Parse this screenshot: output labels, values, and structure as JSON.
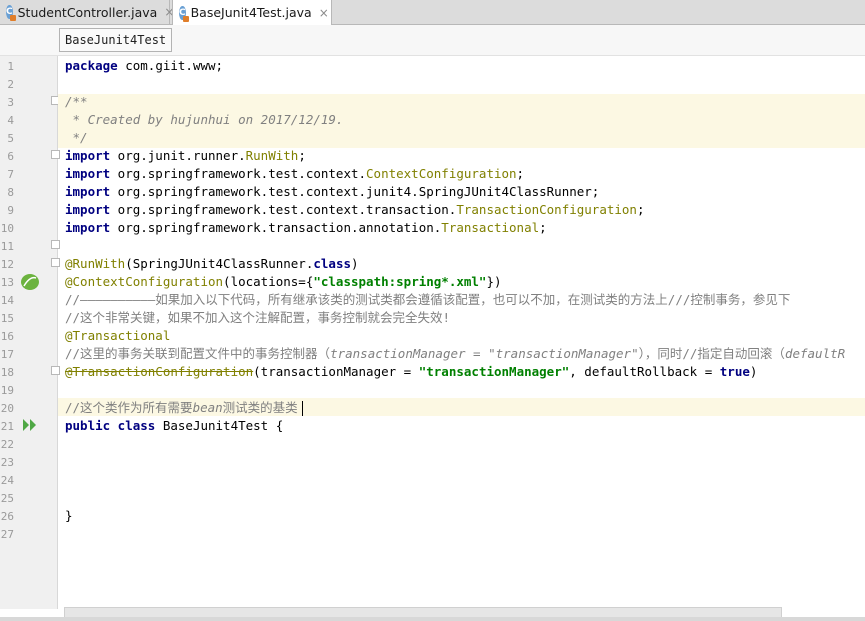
{
  "tabs": [
    {
      "label": "StudentController.java",
      "close": "×",
      "icon": "class-icon"
    },
    {
      "label": "BaseJunit4Test.java",
      "close": "×",
      "icon": "class-icon"
    }
  ],
  "breadcrumb": "BaseJunit4Test",
  "line_numbers": [
    "1",
    "2",
    "3",
    "4",
    "5",
    "6",
    "7",
    "8",
    "9",
    "10",
    "11",
    "12",
    "13",
    "14",
    "15",
    "16",
    "17",
    "18",
    "19",
    "20",
    "21",
    "22",
    "23",
    "24",
    "25",
    "26",
    "27"
  ],
  "code": {
    "l1": {
      "kw": "package",
      "rest": " com.giit.www;"
    },
    "l3": "/**",
    "l4": " * Created by hujunhui on 2017/12/19.",
    "l5": " */",
    "l6": {
      "kw": "import",
      "pkg": " org.junit.runner.",
      "cls": "RunWith",
      "end": ";"
    },
    "l7": {
      "kw": "import",
      "pkg": " org.springframework.test.context.",
      "cls": "ContextConfiguration",
      "end": ";"
    },
    "l8": {
      "kw": "import",
      "pkg": " org.springframework.test.context.junit4.SpringJUnit4ClassRunner;"
    },
    "l9": {
      "kw": "import",
      "pkg": " org.springframework.test.context.transaction.",
      "cls": "TransactionConfiguration",
      "end": ";"
    },
    "l10": {
      "kw": "import",
      "pkg": " org.springframework.transaction.annotation.",
      "cls": "Transactional",
      "end": ";"
    },
    "l12": {
      "ann": "@RunWith",
      "open": "(SpringJUnit4ClassRunner.",
      "kw": "class",
      "close": ")"
    },
    "l13": {
      "ann": "@ContextConfiguration",
      "open": "(locations={",
      "str": "\"classpath:spring*.xml\"",
      "close": "})"
    },
    "l14": "//——————————如果加入以下代码，所有继承该类的测试类都会遵循该配置，也可以不加，在测试类的方法上///控制事务，参见下",
    "l15": "//这个非常关键，如果不加入这个注解配置，事务控制就会完全失效!",
    "l16": "@Transactional",
    "l17a": "//这里的事务关联到配置文件中的事务控制器（",
    "l17b": "transactionManager = \"transactionManager\"",
    "l17c": "），同时//指定自动回滚（",
    "l17d": "defaultR",
    "l18": {
      "ann": "@TransactionConfiguration",
      "open": "(transactionManager = ",
      "str": "\"transactionManager\"",
      "mid": ", defaultRollback = ",
      "kw": "true",
      "close": ")"
    },
    "l20a": "//这个类作为所有需要",
    "l20b": "bean",
    "l20c": "测试类的基类",
    "l21": {
      "kw": "public class",
      "rest": " BaseJunit4Test {"
    },
    "l26": "}"
  }
}
